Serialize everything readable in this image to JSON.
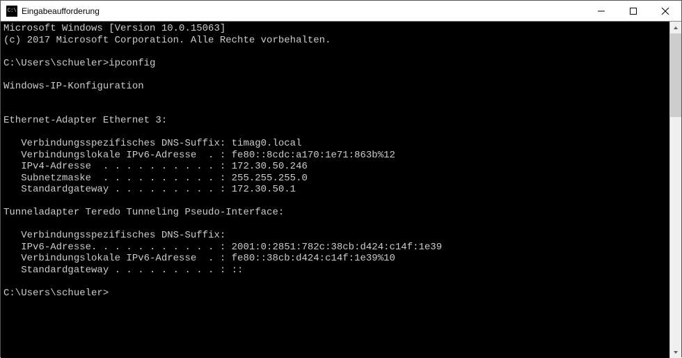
{
  "window": {
    "title": "Eingabeaufforderung",
    "icon_label": "C:\\"
  },
  "terminal": {
    "lines": [
      "Microsoft Windows [Version 10.0.15063]",
      "(c) 2017 Microsoft Corporation. Alle Rechte vorbehalten.",
      "",
      "C:\\Users\\schueler>ipconfig",
      "",
      "Windows-IP-Konfiguration",
      "",
      "",
      "Ethernet-Adapter Ethernet 3:",
      "",
      "   Verbindungsspezifisches DNS-Suffix: timag0.local",
      "   Verbindungslokale IPv6-Adresse  . : fe80::8cdc:a170:1e71:863b%12",
      "   IPv4-Adresse  . . . . . . . . . . : 172.30.50.246",
      "   Subnetzmaske  . . . . . . . . . . : 255.255.255.0",
      "   Standardgateway . . . . . . . . . : 172.30.50.1",
      "",
      "Tunneladapter Teredo Tunneling Pseudo-Interface:",
      "",
      "   Verbindungsspezifisches DNS-Suffix:",
      "   IPv6-Adresse. . . . . . . . . . . : 2001:0:2851:782c:38cb:d424:c14f:1e39",
      "   Verbindungslokale IPv6-Adresse  . : fe80::38cb:d424:c14f:1e39%10",
      "   Standardgateway . . . . . . . . . : ::",
      "",
      "C:\\Users\\schueler>"
    ]
  }
}
